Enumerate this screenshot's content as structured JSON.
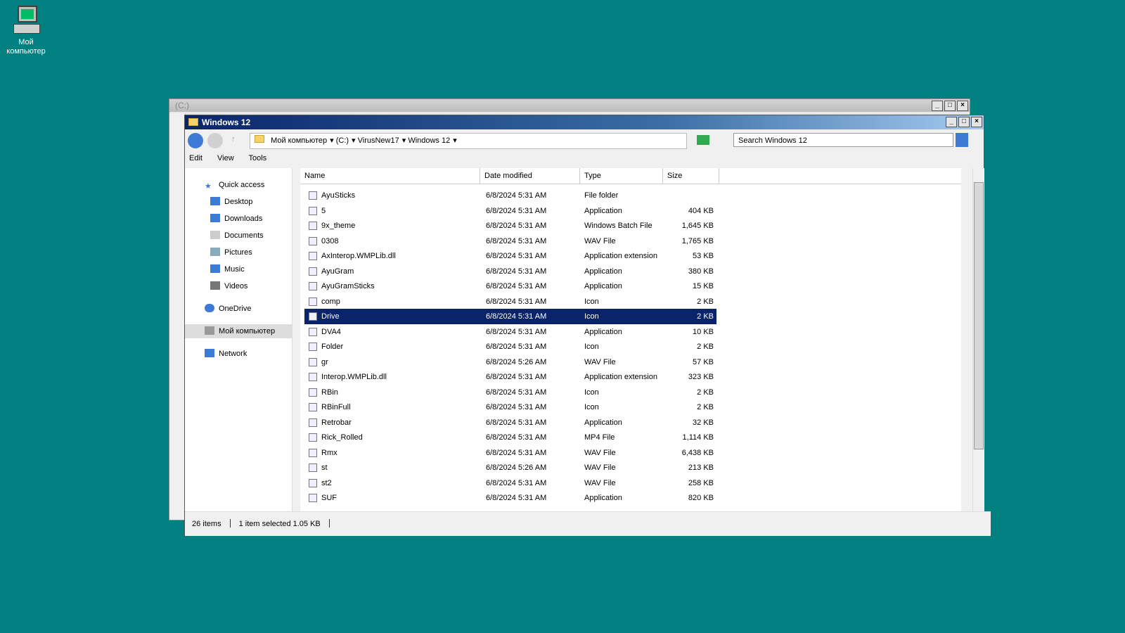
{
  "desktop": {
    "icon_label": "Мой компьютер"
  },
  "back_window": {
    "title": "(C:)"
  },
  "window": {
    "title": "Windows 12",
    "window_controls": {
      "minimize": "_",
      "maximize": "□",
      "close": "×"
    },
    "breadcrumb": [
      "Мой компьютер",
      "(C:)",
      "VirusNew17",
      "Windows 12"
    ],
    "search_placeholder": "Search Windows 12",
    "menu": [
      "Edit",
      "View",
      "Tools"
    ],
    "nav": {
      "quick_access": "Quick access",
      "items": [
        "Desktop",
        "Downloads",
        "Documents",
        "Pictures",
        "Music",
        "Videos"
      ],
      "onedrive": "OneDrive",
      "this_pc": "Мой компьютер",
      "network": "Network"
    },
    "columns": {
      "name": "Name",
      "date": "Date modified",
      "type": "Type",
      "size": "Size"
    },
    "files": [
      {
        "name": "AyuSticks",
        "date": "6/8/2024 5:31 AM",
        "type": "File folder",
        "size": ""
      },
      {
        "name": "5",
        "date": "6/8/2024 5:31 AM",
        "type": "Application",
        "size": "404 KB"
      },
      {
        "name": "9x_theme",
        "date": "6/8/2024 5:31 AM",
        "type": "Windows Batch File",
        "size": "1,645 KB"
      },
      {
        "name": "0308",
        "date": "6/8/2024 5:31 AM",
        "type": "WAV File",
        "size": "1,765 KB"
      },
      {
        "name": "AxInterop.WMPLib.dll",
        "date": "6/8/2024 5:31 AM",
        "type": "Application extension",
        "size": "53 KB"
      },
      {
        "name": "AyuGram",
        "date": "6/8/2024 5:31 AM",
        "type": "Application",
        "size": "380 KB"
      },
      {
        "name": "AyuGramSticks",
        "date": "6/8/2024 5:31 AM",
        "type": "Application",
        "size": "15 KB"
      },
      {
        "name": "comp",
        "date": "6/8/2024 5:31 AM",
        "type": "Icon",
        "size": "2 KB"
      },
      {
        "name": "Drive",
        "date": "6/8/2024 5:31 AM",
        "type": "Icon",
        "size": "2 KB",
        "selected": true
      },
      {
        "name": "DVA4",
        "date": "6/8/2024 5:31 AM",
        "type": "Application",
        "size": "10 KB"
      },
      {
        "name": "Folder",
        "date": "6/8/2024 5:31 AM",
        "type": "Icon",
        "size": "2 KB"
      },
      {
        "name": "gr",
        "date": "6/8/2024 5:26 AM",
        "type": "WAV File",
        "size": "57 KB"
      },
      {
        "name": "Interop.WMPLib.dll",
        "date": "6/8/2024 5:31 AM",
        "type": "Application extension",
        "size": "323 KB"
      },
      {
        "name": "RBin",
        "date": "6/8/2024 5:31 AM",
        "type": "Icon",
        "size": "2 KB"
      },
      {
        "name": "RBinFull",
        "date": "6/8/2024 5:31 AM",
        "type": "Icon",
        "size": "2 KB"
      },
      {
        "name": "Retrobar",
        "date": "6/8/2024 5:31 AM",
        "type": "Application",
        "size": "32 KB"
      },
      {
        "name": "Rick_Rolled",
        "date": "6/8/2024 5:31 AM",
        "type": "MP4 File",
        "size": "1,114 KB"
      },
      {
        "name": "Rmx",
        "date": "6/8/2024 5:31 AM",
        "type": "WAV File",
        "size": "6,438 KB"
      },
      {
        "name": "st",
        "date": "6/8/2024 5:26 AM",
        "type": "WAV File",
        "size": "213 KB"
      },
      {
        "name": "st2",
        "date": "6/8/2024 5:31 AM",
        "type": "WAV File",
        "size": "258 KB"
      },
      {
        "name": "SUF",
        "date": "6/8/2024 5:31 AM",
        "type": "Application",
        "size": "820 KB"
      }
    ],
    "status": {
      "count": "26 items",
      "selection": "1 item selected  1.05 KB"
    }
  },
  "colors": {
    "desktop": "#008080",
    "selection": "#0a246a"
  }
}
